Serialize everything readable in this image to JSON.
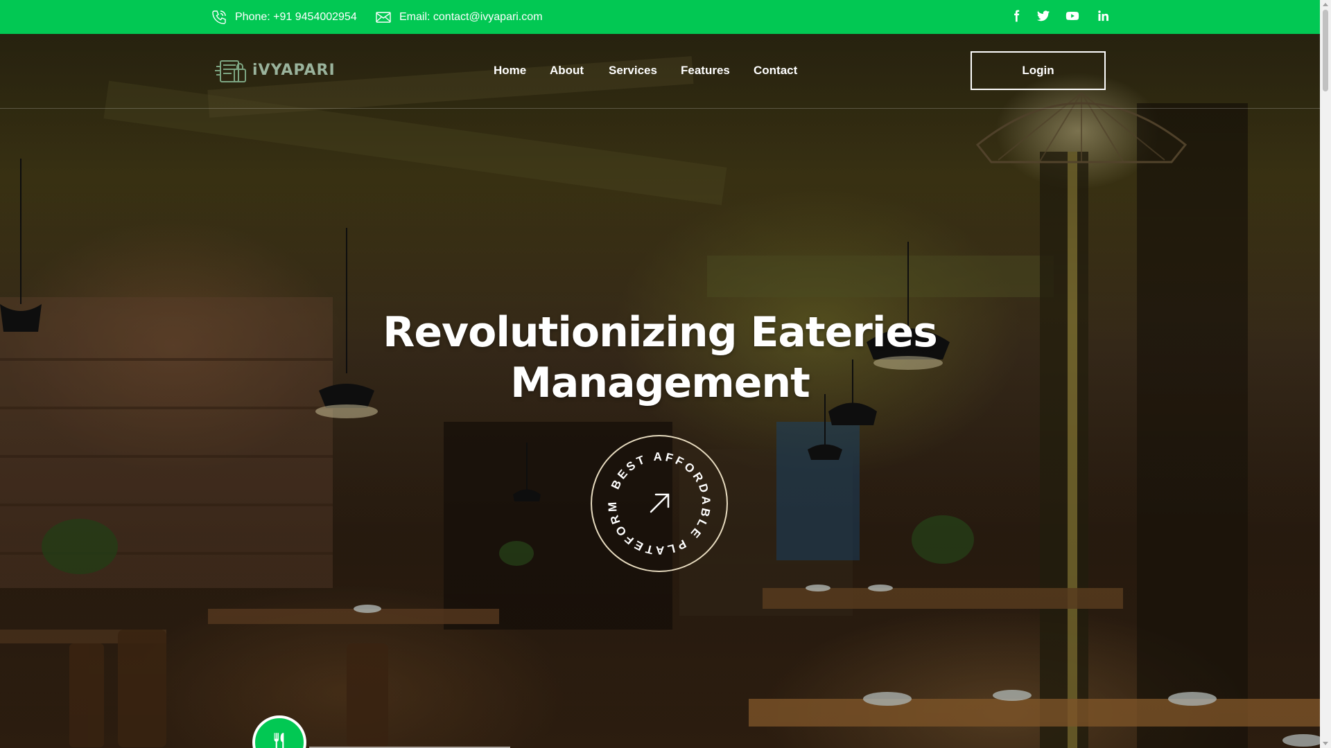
{
  "topbar": {
    "phone_text": "Phone: +91 9454002954",
    "email_text": "Email: contact@ivyapari.com",
    "social_icons": [
      "facebook-icon",
      "twitter-icon",
      "youtube-icon",
      "linkedin-icon"
    ],
    "background_color": "#02c853"
  },
  "nav": {
    "logo_text": "iVYAPARI",
    "links": [
      "Home",
      "About",
      "Services",
      "Features",
      "Contact"
    ],
    "login_label": "Login"
  },
  "hero": {
    "headline_line1": "Revolutionizing Eateries",
    "headline_line2": "Management",
    "badge_text": "BEST AFFORDABLE PLATEFORM",
    "badge_icon": "arrow-up-right-icon",
    "feature_icon": "fork-knife-icon",
    "accent_color": "#02c853"
  }
}
